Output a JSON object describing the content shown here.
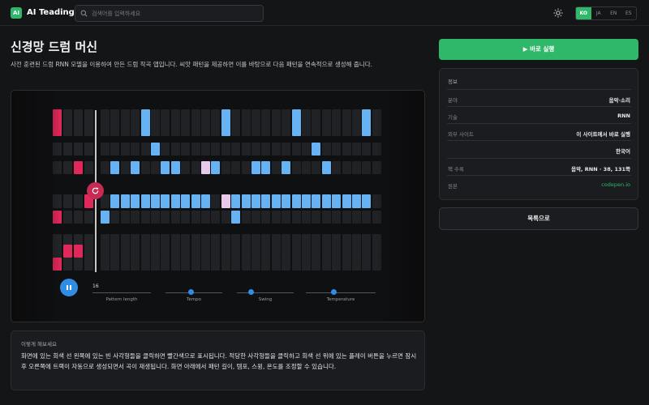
{
  "header": {
    "logo": "AI",
    "brand": "AI Teading",
    "search_placeholder": "검색어를 입력하세요",
    "languages": [
      "KO",
      "JA",
      "EN",
      "ES"
    ],
    "active_language": "KO"
  },
  "page": {
    "title": "신경망 드럼 머신",
    "description": "사전 훈련된 드럼 RNN 모델을 이용하여 만든 드럼 작곡 앱입니다. 씨앗 패턴을 제공하면 이를 바탕으로 다음 패턴을 연속적으로 생성해 줍니다."
  },
  "player": {
    "pattern_length": "16",
    "controls": [
      {
        "name": "pattern-length",
        "label": "Pattern length",
        "value": 16
      },
      {
        "name": "tempo",
        "label": "Tempo",
        "value": 0.45
      },
      {
        "name": "swing",
        "label": "Swing",
        "value": 0.25
      },
      {
        "name": "temperature",
        "label": "Temperature",
        "value": 0.4
      }
    ],
    "steps": 32,
    "seed_steps": 4,
    "pattern_rows": [
      {
        "red": [
          0
        ],
        "blue": [
          8,
          16,
          23,
          30
        ],
        "pink": []
      },
      {
        "red": [],
        "blue": [
          9,
          25
        ],
        "pink": []
      },
      {
        "red": [
          2
        ],
        "blue": [
          5,
          7,
          10,
          11,
          15,
          19,
          20,
          22,
          26
        ],
        "pink": [
          14
        ]
      },
      {
        "red": [
          3
        ],
        "blue": [
          5,
          6,
          7,
          8,
          9,
          10,
          11,
          12,
          13,
          14,
          17,
          18,
          19,
          20,
          21,
          22,
          23,
          24,
          25,
          26,
          27,
          28,
          29,
          30
        ],
        "pink": [
          16
        ]
      },
      {
        "red": [
          0
        ],
        "blue": [
          4,
          17
        ],
        "pink": []
      },
      {
        "red": [],
        "blue": [],
        "pink": []
      },
      {
        "red": [
          1,
          2
        ],
        "blue": [],
        "pink": []
      },
      {
        "red": [
          0
        ],
        "blue": [],
        "pink": []
      }
    ]
  },
  "hint": {
    "title": "이렇게 해보세요",
    "text": "화면에 있는 회색 선 왼쪽에 있는 빈 사각형들을 클릭하면 빨간색으로 표시됩니다. 적당한 사각형들을 클릭하고 회색 선 위에 있는 플레이 버튼을 누르면 잠시 후 오른쪽에 트랙이 자동으로 생성되면서 곡이 재생됩니다. 화면 아래에서 패턴 길이, 템포, 스윙, 온도를 조정할 수 있습니다."
  },
  "sidebar": {
    "run_label": "▶ 바로 실행",
    "info_title": "정보",
    "rows": [
      {
        "key": "분야",
        "value": "음악·소리"
      },
      {
        "key": "기술",
        "value": "RNN"
      },
      {
        "key": "외부 사이트",
        "value": "이 사이트에서 바로 실행"
      },
      {
        "key": "",
        "value": "한국어"
      },
      {
        "key": "책 수록",
        "value": "음악, RNN · 38, 131쪽"
      },
      {
        "key": "원본",
        "value": "codepen.io"
      }
    ],
    "list_label": "목록으로"
  },
  "colors": {
    "accent": "#2fb86a",
    "seed": "#e0285a",
    "generated": "#66b2f2",
    "control": "#2f8de4"
  }
}
